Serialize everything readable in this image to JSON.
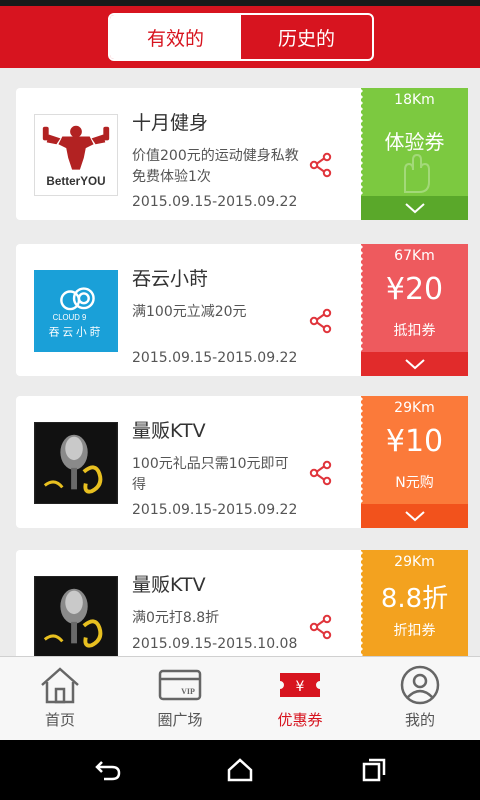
{
  "header": {
    "tabs": [
      {
        "label": "有效的",
        "active": true
      },
      {
        "label": "历史的",
        "active": false
      }
    ]
  },
  "coupons": [
    {
      "logo": "betteryou-logo",
      "logo_text": "BetterYOU",
      "title": "十月健身",
      "desc": "价值200元的运动健身私教免费体验1次",
      "date": "2015.09.15-2015.09.22",
      "distance": "18Km",
      "main": "体验券",
      "sub": "",
      "color": "#7cc940",
      "dark": "#5aa82a"
    },
    {
      "logo": "cloud9-logo",
      "logo_text_1": "CLOUD 9",
      "logo_text_2": "吞云小莳",
      "title": "吞云小莳",
      "desc": "满100元立减20元",
      "date": "2015.09.15-2015.09.22",
      "distance": "67Km",
      "main": "¥20",
      "sub": "抵扣券",
      "color": "#ee5a5e",
      "dark": "#e12b2b"
    },
    {
      "logo": "ktv-logo",
      "title": "量贩KTV",
      "desc": "100元礼品只需10元即可得",
      "date": "2015.09.15-2015.09.22",
      "distance": "29Km",
      "main": "¥10",
      "sub": "N元购",
      "color": "#fb7a3a",
      "dark": "#f2521c"
    },
    {
      "logo": "ktv-logo",
      "title": "量贩KTV",
      "desc": "满0元打8.8折",
      "date": "2015.09.15-2015.10.08",
      "distance": "29Km",
      "main": "8.8折",
      "sub": "折扣券",
      "color": "#f3a21f",
      "dark": "#e08a10"
    }
  ],
  "tabbar": [
    {
      "label": "首页",
      "icon": "home-icon",
      "active": false
    },
    {
      "label": "圈广场",
      "icon": "card-icon",
      "active": false
    },
    {
      "label": "优惠券",
      "icon": "ticket-icon",
      "active": true
    },
    {
      "label": "我的",
      "icon": "profile-icon",
      "active": false
    }
  ],
  "colors": {
    "brand": "#d7141f"
  }
}
